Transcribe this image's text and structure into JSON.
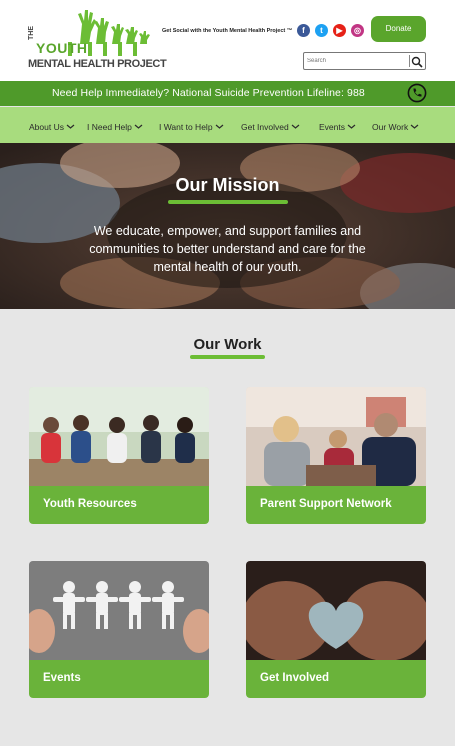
{
  "header": {
    "logo": {
      "line1": "THE",
      "line2": "YOUTH",
      "line3": "MENTAL HEALTH PROJECT"
    },
    "social_text": "Get Social with the Youth Mental Health Project ™",
    "social_icons": [
      "facebook-icon",
      "twitter-icon",
      "youtube-icon",
      "instagram-icon"
    ],
    "donate_label": "Donate",
    "search_placeholder": "Search"
  },
  "lifeline": {
    "text": "Need Help Immediately? National Suicide Prevention Lifeline: 988"
  },
  "nav": {
    "items": [
      {
        "label": "About Us"
      },
      {
        "label": "I Need Help"
      },
      {
        "label": "I Want to Help"
      },
      {
        "label": "Get Involved"
      },
      {
        "label": "Events"
      },
      {
        "label": "Our Work"
      }
    ]
  },
  "hero": {
    "title": "Our Mission",
    "text": "We educate, empower, and support families and communities to better understand and care for the mental health of our youth."
  },
  "work": {
    "title": "Our Work",
    "cards": [
      {
        "label": "Youth Resources"
      },
      {
        "label": "Parent Support Network"
      },
      {
        "label": "Events"
      },
      {
        "label": "Get Involved"
      }
    ]
  },
  "colors": {
    "green_dark": "#4f9a2a",
    "green_accent": "#6cbd35",
    "green_light": "#a8dc7e",
    "card_bar": "#6ab33a",
    "background": "#e6e6e6"
  }
}
